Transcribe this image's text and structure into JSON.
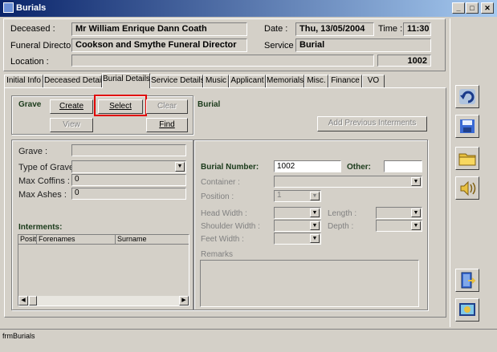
{
  "window": {
    "title": "Burials"
  },
  "header": {
    "deceased_label": "Deceased :",
    "deceased_value": "Mr William Enrique Dann Coath",
    "date_label": "Date :",
    "date_value": "Thu, 13/05/2004",
    "time_label": "Time :",
    "time_value": "11:30",
    "funeral_director_label": "Funeral Director :",
    "funeral_director_value": "Cookson and Smythe Funeral Director",
    "service_label": "Service :",
    "service_value": "Burial",
    "location_label": "Location :",
    "location_value": "",
    "id_value": "1002"
  },
  "tabs": [
    "Initial Info",
    "Deceased Details",
    "Burial Details",
    "Service Details",
    "Music",
    "Applicant",
    "Memorials",
    "Misc.",
    "Finance",
    "VO"
  ],
  "grave_section": {
    "title": "Grave",
    "create_label": "Create",
    "select_label": "Select",
    "clear_label": "Clear",
    "view_label": "View",
    "find_label": "Find"
  },
  "burial_section": {
    "title": "Burial",
    "add_previous_label": "Add Previous Interments"
  },
  "grave_details": {
    "grave_label": "Grave :",
    "type_label": "Type of Grave :",
    "max_coffins_label": "Max Coffins :",
    "max_coffins_value": "0",
    "max_ashes_label": "Max Ashes :",
    "max_ashes_value": "0",
    "interments_label": "Interments:",
    "columns": [
      "Posit",
      "Forenames",
      "Surname"
    ]
  },
  "burial_details": {
    "burial_number_label": "Burial Number:",
    "burial_number_value": "1002",
    "other_label": "Other:",
    "other_value": "",
    "container_label": "Container :",
    "position_label": "Position :",
    "position_value": "1",
    "head_width_label": "Head Width :",
    "length_label": "Length :",
    "shoulder_width_label": "Shoulder Width :",
    "depth_label": "Depth :",
    "feet_width_label": "Feet Width :",
    "remarks_label": "Remarks"
  },
  "status": {
    "text": "frmBurials"
  },
  "colors": {
    "highlight": "#e00000",
    "title_bar": "#0a246a",
    "dark_label": "#1a3a1a"
  }
}
